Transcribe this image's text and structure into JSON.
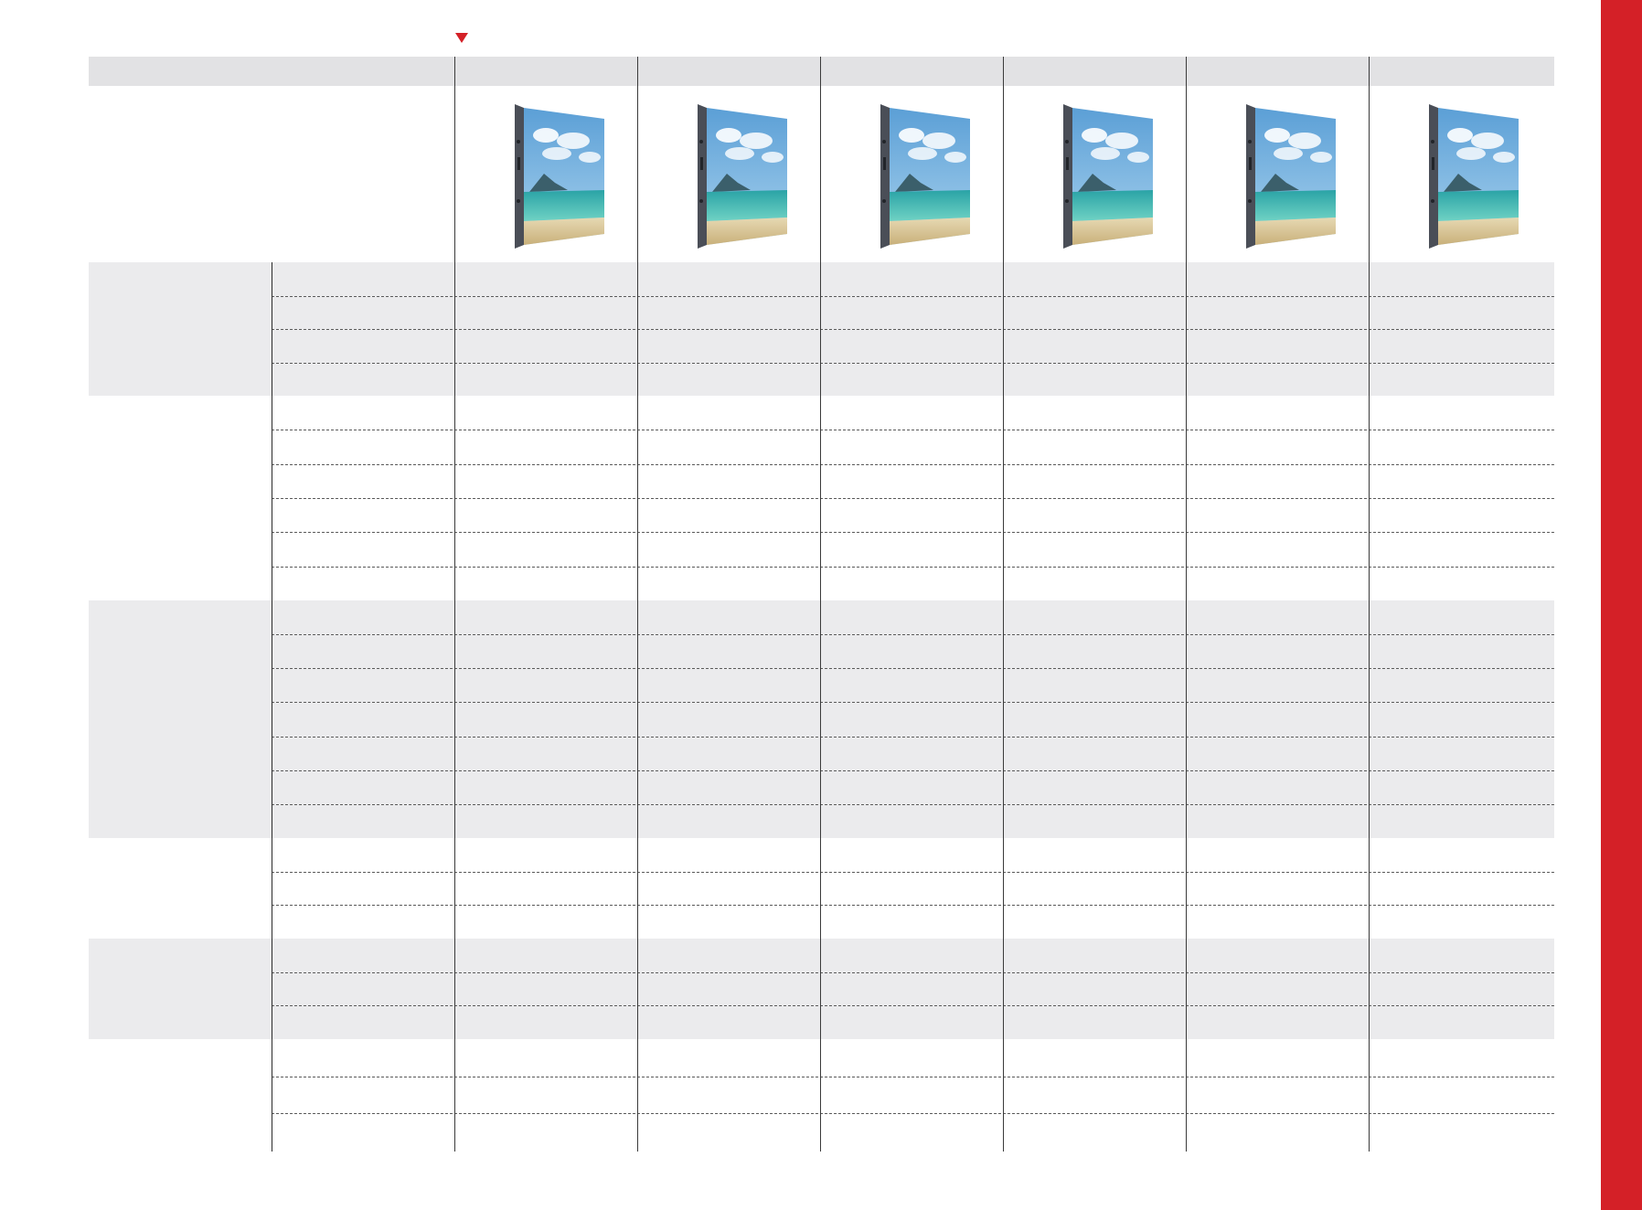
{
  "page": {
    "accent_color": "#d42027",
    "header_band_color": "#e2e2e4",
    "group_band_color": "#ebebed",
    "marker_icon": "triangle-down-icon"
  },
  "table": {
    "header_title": "",
    "product_columns": [
      {
        "name": "",
        "image": "led-cabinet-beach-image"
      },
      {
        "name": "",
        "image": "led-cabinet-beach-image"
      },
      {
        "name": "",
        "image": "led-cabinet-beach-image"
      },
      {
        "name": "",
        "image": "led-cabinet-beach-image"
      },
      {
        "name": "",
        "image": "led-cabinet-beach-image"
      },
      {
        "name": "",
        "image": "led-cabinet-beach-image"
      }
    ],
    "groups": [
      {
        "label": "",
        "shaded": true,
        "rows": 4
      },
      {
        "label": "",
        "shaded": false,
        "rows": 6
      },
      {
        "label": "",
        "shaded": true,
        "rows": 7
      },
      {
        "label": "",
        "shaded": false,
        "rows": 3
      },
      {
        "label": "",
        "shaded": true,
        "rows": 3
      },
      {
        "label": "",
        "shaded": false,
        "rows": 3
      }
    ]
  }
}
